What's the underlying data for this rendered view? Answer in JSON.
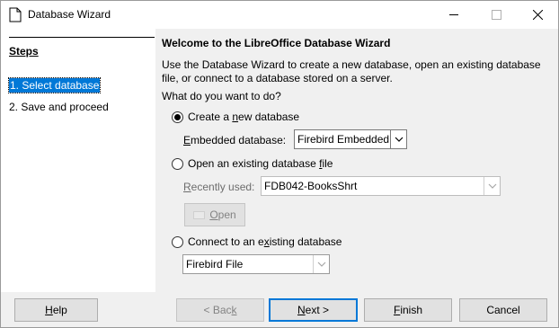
{
  "window": {
    "title": "Database Wizard"
  },
  "steps": {
    "title": "Steps",
    "items": [
      "1. Select database",
      "2. Save and proceed"
    ]
  },
  "main": {
    "heading": "Welcome to the LibreOffice Database Wizard",
    "description": "Use the Database Wizard to create a new database, open an existing database file, or connect to a database stored on a server.",
    "question": "What do you want to do?",
    "create_new": {
      "label_pre": "Create a ",
      "label_key": "n",
      "label_post": "ew database",
      "selected": true,
      "embedded_label_pre": "",
      "embedded_label_key": "E",
      "embedded_label_post": "mbedded database:",
      "embedded_value": "Firebird Embedded"
    },
    "open_existing": {
      "label_pre": "Open an existing database ",
      "label_key": "f",
      "label_post": "ile",
      "selected": false,
      "recent_label_pre": "",
      "recent_label_key": "R",
      "recent_label_post": "ecently used:",
      "recent_value": "FDB042-BooksShrt",
      "open_label_key": "O",
      "open_label_post": "pen"
    },
    "connect_existing": {
      "label_pre": "Connect to an e",
      "label_key": "x",
      "label_post": "isting database",
      "selected": false,
      "type_value": "Firebird File"
    }
  },
  "buttons": {
    "help_key": "H",
    "help_post": "elp",
    "back_pre": "< Bac",
    "back_key": "k",
    "next_key": "N",
    "next_post": "ext >",
    "finish_key": "F",
    "finish_post": "inish",
    "cancel": "Cancel"
  }
}
